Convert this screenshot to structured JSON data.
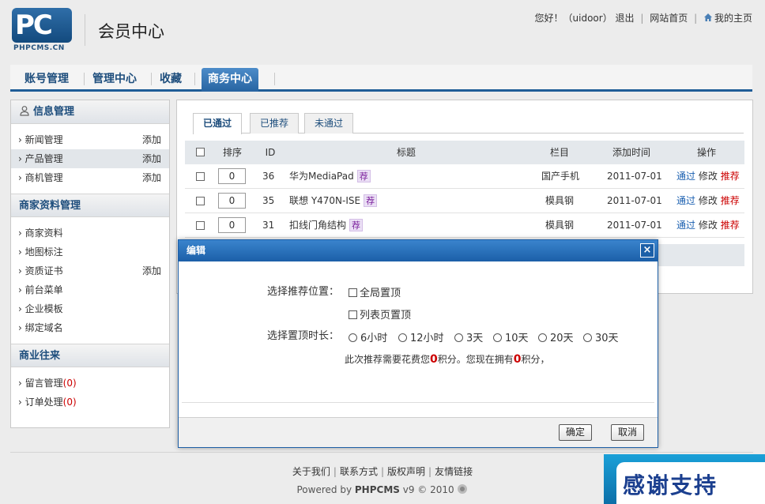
{
  "header": {
    "logo_letters": "PC",
    "logo_text": "PHPCMS.CN",
    "site_title": "会员中心",
    "greeting": "您好！（uidoor）",
    "logout": "退出",
    "site_home": "网站首页",
    "my_home": "我的主页"
  },
  "mainnav": {
    "tabs": [
      "账号管理",
      "管理中心",
      "收藏",
      "商务中心"
    ],
    "active": "商务中心"
  },
  "sidebar": {
    "sections": [
      {
        "title": "信息管理",
        "items": [
          {
            "label": "新闻管理",
            "action": "添加"
          },
          {
            "label": "产品管理",
            "action": "添加"
          },
          {
            "label": "商机管理",
            "action": "添加"
          }
        ]
      },
      {
        "title": "商家资料管理",
        "items": [
          {
            "label": "商家资料"
          },
          {
            "label": "地图标注"
          },
          {
            "label": "资质证书",
            "action": "添加"
          },
          {
            "label": "前台菜单"
          },
          {
            "label": "企业模板"
          },
          {
            "label": "绑定域名"
          }
        ]
      },
      {
        "title": "商业往来",
        "items": [
          {
            "label": "留言管理",
            "count": "(0)"
          },
          {
            "label": "订单处理",
            "count": "(0)"
          }
        ]
      }
    ],
    "item_prefix": "›"
  },
  "content": {
    "tabs": [
      "已通过",
      "已推荐",
      "未通过"
    ],
    "columns": [
      "排序",
      "ID",
      "标题",
      "栏目",
      "添加时间",
      "操作"
    ],
    "rows": [
      {
        "order": "0",
        "id": "36",
        "title": "华为MediaPad",
        "tag": "荐",
        "column": "国产手机",
        "date": "2011-07-01"
      },
      {
        "order": "0",
        "id": "35",
        "title": "联想 Y470N-ISE",
        "tag": "荐",
        "column": "模具钢",
        "date": "2011-07-01"
      },
      {
        "order": "0",
        "id": "31",
        "title": "扣线门角结构",
        "tag": "荐",
        "column": "模具钢",
        "date": "2011-07-01"
      }
    ],
    "ops": {
      "pass": "通过",
      "edit": "修改",
      "recommend": "推荐"
    }
  },
  "modal": {
    "title": "编辑",
    "close": "×",
    "position_label": "选择推荐位置：",
    "positions": [
      "全局置顶",
      "列表页置顶"
    ],
    "duration_label": "选择置顶时长：",
    "durations": [
      "6小时",
      "12小时",
      "3天",
      "10天",
      "20天",
      "30天"
    ],
    "cost_prefix": "此次推荐需要花费您",
    "cost_value": "0",
    "cost_middle": "积分。您现在拥有",
    "have_value": "0",
    "cost_suffix": "积分，",
    "ok": "确定",
    "cancel": "取消"
  },
  "footer": {
    "links": [
      "关于我们",
      "联系方式",
      "版权声明",
      "友情链接"
    ],
    "powered_prefix": "Powered by",
    "powered_brand": "PHPCMS",
    "powered_suffix": "v9 © 2010"
  },
  "banner": {
    "text": "感谢支持"
  }
}
